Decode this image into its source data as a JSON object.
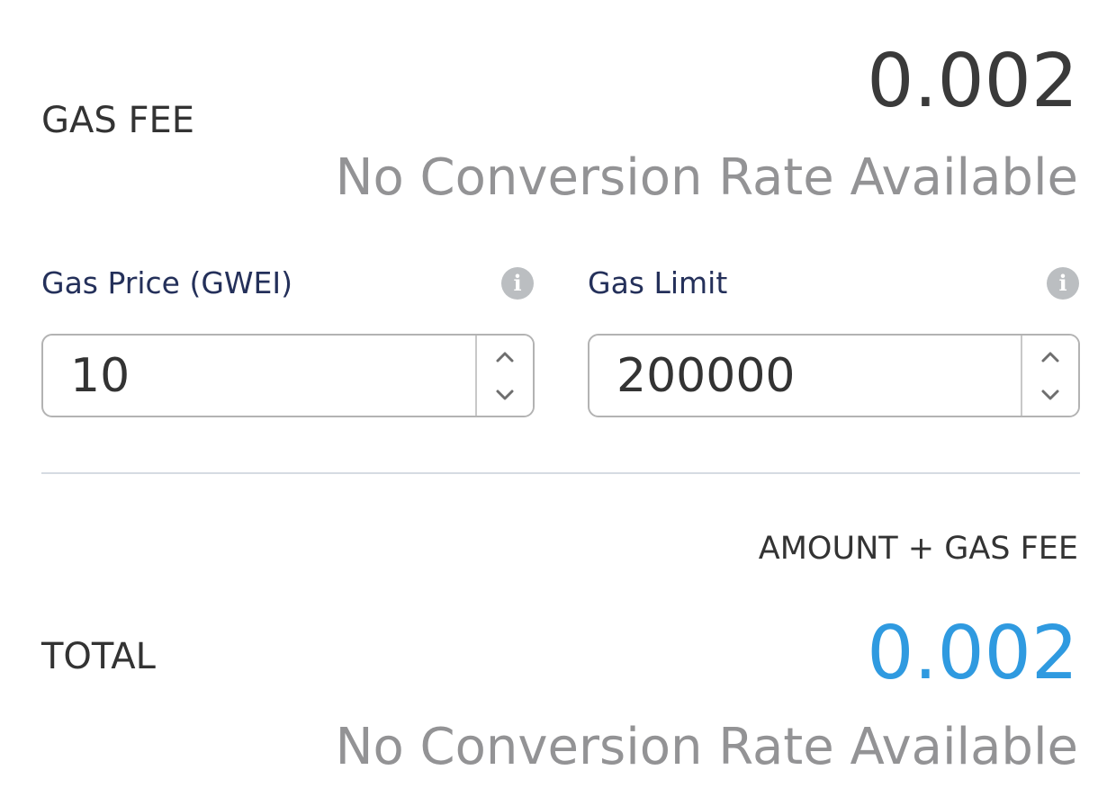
{
  "gas_fee": {
    "label": "GAS FEE",
    "amount": "0.002",
    "conversion": "No Conversion Rate Available"
  },
  "gas_price": {
    "label": "Gas Price (GWEI)",
    "value": "10",
    "info_icon": "info-icon"
  },
  "gas_limit": {
    "label": "Gas Limit",
    "value": "200000",
    "info_icon": "info-icon"
  },
  "total": {
    "caption": "AMOUNT + GAS FEE",
    "label": "TOTAL",
    "amount": "0.002",
    "conversion": "No Conversion Rate Available"
  },
  "colors": {
    "total_amount": "#2f9ae0",
    "gas_fee_amount": "#3a3a3a",
    "field_label": "#24305a",
    "muted": "#939395"
  }
}
